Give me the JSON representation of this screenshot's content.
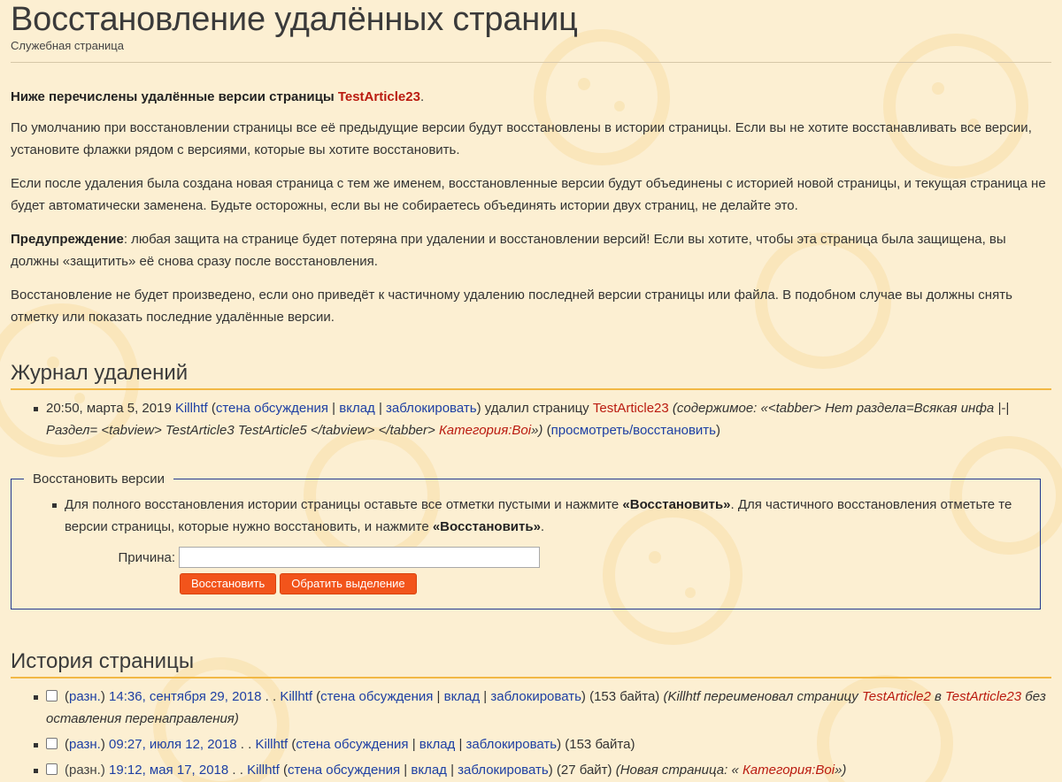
{
  "title": "Восстановление удалённых страниц",
  "subtitle": "Служебная страница",
  "intro": {
    "text": "Ниже перечислены удалённые версии страницы ",
    "link": "TestArticle23",
    "end": "."
  },
  "paragraphs": [
    "По умолчанию при восстановлении страницы все её предыдущие версии будут восстановлены в истории страницы. Если вы не хотите восстанавливать все версии, установите флажки рядом с версиями, которые вы хотите восстановить.",
    "Если после удаления была создана новая страница с тем же именем, восстановленные версии будут объединены с историей новой страницы, и текущая страница не будет автоматически заменена. Будьте осторожны, если вы не собираетесь объединять истории двух страниц, не делайте это.",
    "Восстановление не будет произведено, если оно приведёт к частичному удалению последней версии страницы или файла. В подобном случае вы должны снять отметку или показать последние удалённые версии."
  ],
  "warning": {
    "label": "Предупреждение",
    "text": ": любая защита на странице будет потеряна при удалении и восстановлении версий! Если вы хотите, чтобы эта страница была защищена, вы должны «защитить» её снова сразу после восстановления."
  },
  "deletion_log": {
    "heading": "Журнал удалений",
    "entry": {
      "time": "20:50, марта 5, 2019 ",
      "user": "Killhtf",
      "open_paren": " (",
      "talk": "стена обсуждения",
      "sep": " | ",
      "contribs": "вклад",
      "block": "заблокировать",
      "close_action": ") удалил страницу ",
      "page": "TestArticle23",
      "summary_prefix": " (содержимое: «<tabber> Нет раздела=Всякая инфа |-|Раздел= <tabview> TestArticle3 TestArticle5 </tabview> </tabber> ",
      "category": "Категория:Boi",
      "summary_suffix": "»)",
      "view_restore": "просмотреть/восстановить"
    }
  },
  "restore": {
    "legend": "Восстановить версии",
    "instruction_1": "Для полного восстановления истории страницы оставьте все отметки пустыми и нажмите ",
    "bold_1": "«Восстановить»",
    "instruction_2": ". Для частичного восстановления отметьте те версии страницы, которые нужно восстановить, и нажмите ",
    "bold_2": "«Восстановить»",
    "instruction_3": ".",
    "reason_label": "Причина:",
    "reason_value": "",
    "restore_button": "Восстановить",
    "invert_button": "Обратить выделение"
  },
  "history": {
    "heading": "История страницы",
    "diff_label": "разн.",
    "talk": "стена обсуждения",
    "contribs": "вклад",
    "block": "заблокировать",
    "rows": [
      {
        "diff_linked": true,
        "time": "14:36, сентября 29, 2018",
        "user": "Killhtf",
        "size": "(153 байта)",
        "summary_a": "(Killhtf переименовал страницу ",
        "link_from": "TestArticle2",
        "summary_b": " в ",
        "link_to": "TestArticle23",
        "summary_c": " без оставления перенаправления)"
      },
      {
        "diff_linked": true,
        "time": "09:27, июля 12, 2018",
        "user": "Killhtf",
        "size": "(153 байта)"
      },
      {
        "diff_linked": false,
        "time": "19:12, мая 17, 2018",
        "user": "Killhtf",
        "size": "(27 байт)",
        "summary_a": "(Новая страница: « ",
        "category": "Категория:Boi",
        "summary_c": "»)"
      }
    ]
  }
}
